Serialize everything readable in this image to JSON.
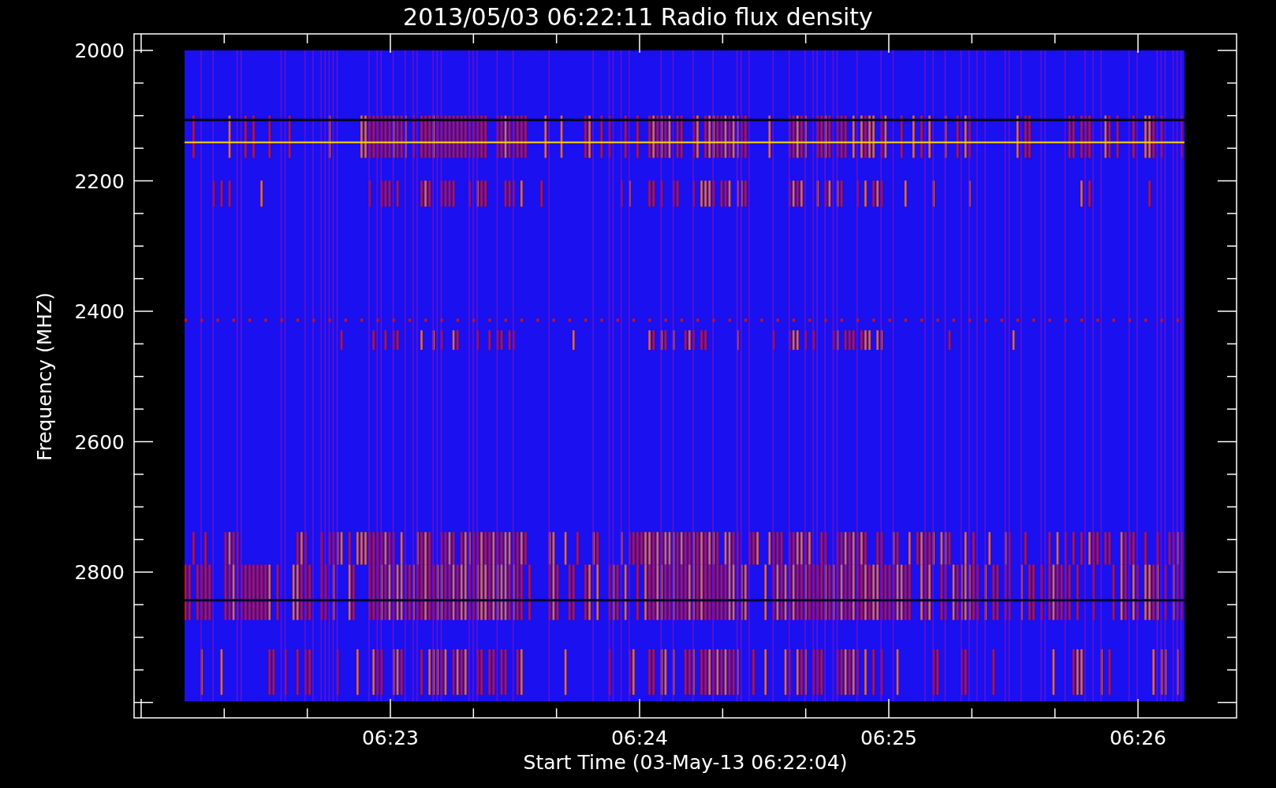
{
  "title": "2013/05/03 06:22:11 Radio flux density",
  "y_axis": {
    "title": "Frequency (MHZ)",
    "tick_labels": [
      "2000",
      "2200",
      "2400",
      "2600",
      "2800"
    ]
  },
  "x_axis": {
    "title": "Start Time (03-May-13 06:22:04)",
    "tick_labels": [
      "06:23",
      "06:24",
      "06:25",
      "06:26"
    ]
  }
}
